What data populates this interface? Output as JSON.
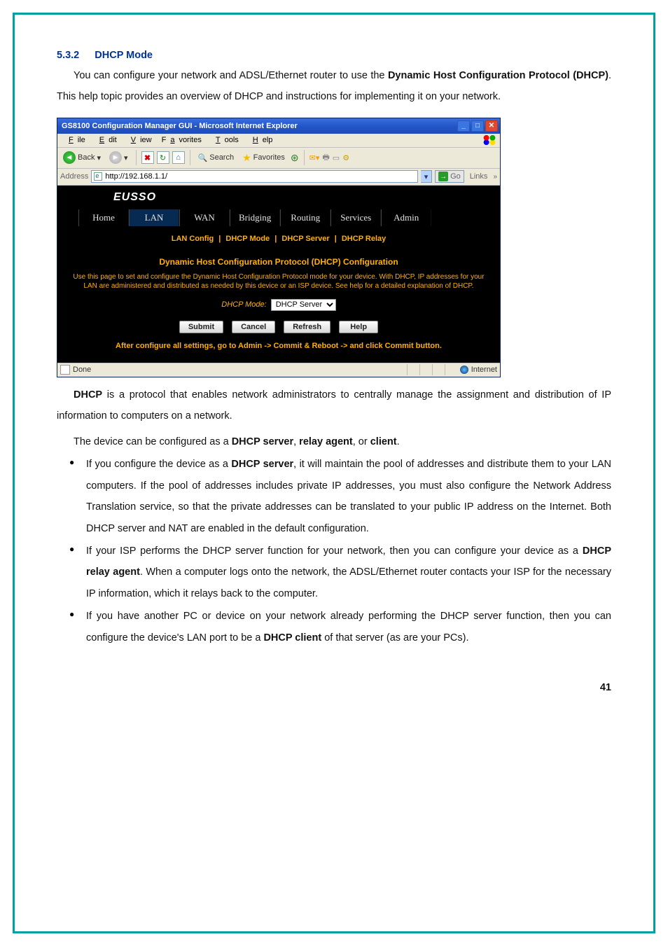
{
  "section": {
    "number": "5.3.2",
    "title": "DHCP Mode"
  },
  "para1_a": "You can configure your network and ADSL/Ethernet router to use the ",
  "para1_b": "Dynamic Host Configuration Protocol (DHCP)",
  "para1_c": ". This help topic provides an overview of DHCP and instructions for implementing it on your network.",
  "browser": {
    "title": "GS8100 Configuration Manager GUI - Microsoft Internet Explorer",
    "menus": {
      "file": "File",
      "edit": "Edit",
      "view": "View",
      "favorites": "Favorites",
      "tools": "Tools",
      "help": "Help"
    },
    "toolbar": {
      "back": "Back",
      "search": "Search",
      "favorites": "Favorites"
    },
    "address_label": "Address",
    "address_value": "http://192.168.1.1/",
    "go": "Go",
    "links": "Links",
    "status_done": "Done",
    "status_zone": "Internet"
  },
  "router": {
    "logo": "EUSSO",
    "tabs": {
      "home": "Home",
      "lan": "LAN",
      "wan": "WAN",
      "bridging": "Bridging",
      "routing": "Routing",
      "services": "Services",
      "admin": "Admin"
    },
    "submenu": {
      "a": "LAN Config",
      "b": "DHCP Mode",
      "c": "DHCP Server",
      "d": "DHCP Relay",
      "sep": "|"
    },
    "content_title": "Dynamic Host Configuration Protocol (DHCP) Configuration",
    "content_note": "Use this page to set and configure the Dynamic Host Configuration Protocol mode for your device. With DHCP, IP addresses for your LAN are administered and distributed as needed by this device or an ISP device. See help for a detailed explanation of DHCP.",
    "mode_label": "DHCP Mode:",
    "mode_value": "DHCP Server",
    "buttons": {
      "submit": "Submit",
      "cancel": "Cancel",
      "refresh": "Refresh",
      "help": "Help"
    },
    "footnote": "After configure all settings, go to Admin -> Commit & Reboot -> and click Commit button."
  },
  "para2_a": "DHCP",
  "para2_b": " is a protocol that enables network administrators to centrally manage the assignment and distribution of IP information to computers on a network.",
  "para3_a": "The device can be configured as a ",
  "para3_b": "DHCP server",
  "para3_c": ", ",
  "para3_d": "relay agent",
  "para3_e": ", or ",
  "para3_f": "client",
  "para3_g": ".",
  "bullets": {
    "b1_a": "If you configure the device as a ",
    "b1_b": "DHCP server",
    "b1_c": ", it will maintain the pool of addresses and distribute them to your LAN computers. If the pool of addresses includes private IP addresses, you must also configure the Network Address Translation service, so that the private addresses can be translated to your public IP address on the Internet. Both DHCP server and NAT are enabled in the default configuration.",
    "b2_a": "If your ISP performs the DHCP server function for your network, then you can configure your device as a ",
    "b2_b": "DHCP relay agent",
    "b2_c": ". When a computer logs onto the network, the ADSL/Ethernet router contacts your ISP for the necessary IP information, which it relays back to the computer.",
    "b3_a": "If you have another PC or device on your network already performing the DHCP server function, then you can configure the device's LAN port to be a ",
    "b3_b": "DHCP client",
    "b3_c": " of that server (as are your PCs)."
  },
  "page_number": "41"
}
